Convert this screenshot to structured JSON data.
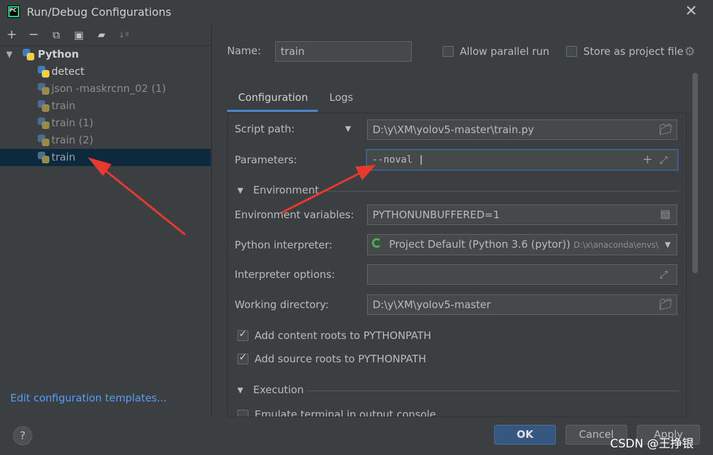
{
  "window": {
    "title": "Run/Debug Configurations",
    "app_icon_text": "PC"
  },
  "toolbar": {
    "add": "+",
    "remove": "−",
    "copy": "⧉",
    "save": "▣",
    "folder": "▰",
    "sort": "↓ª"
  },
  "tree": {
    "root": "Python",
    "items": [
      {
        "label": "detect",
        "dim": false
      },
      {
        "label": "json -maskrcnn_02 (1)",
        "dim": true
      },
      {
        "label": "train",
        "dim": true
      },
      {
        "label": "train (1)",
        "dim": true
      },
      {
        "label": "train (2)",
        "dim": true
      },
      {
        "label": "train",
        "dim": true,
        "selected": true
      }
    ]
  },
  "edit_templates": "Edit configuration templates...",
  "header": {
    "name_label": "Name:",
    "name_value": "train",
    "allow_parallel": "Allow parallel run",
    "store_project": "Store as project file"
  },
  "tabs": [
    "Configuration",
    "Logs"
  ],
  "form": {
    "script_path_label": "Script path:",
    "script_path_value": "D:\\y\\XM\\yolov5-master\\train.py",
    "parameters_label": "Parameters:",
    "parameters_value": "--noval",
    "environment_section": "Environment",
    "env_vars_label": "Environment variables:",
    "env_vars_value": "PYTHONUNBUFFERED=1",
    "interpreter_label": "Python interpreter:",
    "interpreter_value": "Project Default (Python 3.6 (pytor))",
    "interpreter_path": "D:\\x\\anaconda\\envs\\p",
    "interp_options_label": "Interpreter options:",
    "interp_options_value": "",
    "working_dir_label": "Working directory:",
    "working_dir_value": "D:\\y\\XM\\yolov5-master",
    "content_roots": "Add content roots to PYTHONPATH",
    "source_roots": "Add source roots to PYTHONPATH",
    "execution_section": "Execution",
    "emulate_terminal": "Emulate terminal in output console"
  },
  "buttons": {
    "help": "?",
    "ok": "OK",
    "cancel": "Cancel",
    "apply": "Apply"
  },
  "watermark": "CSDN @王挣银",
  "colors": {
    "accent": "#4a88c7",
    "arrow": "#e8392f",
    "selection": "#0d293e",
    "link": "#589df6"
  }
}
